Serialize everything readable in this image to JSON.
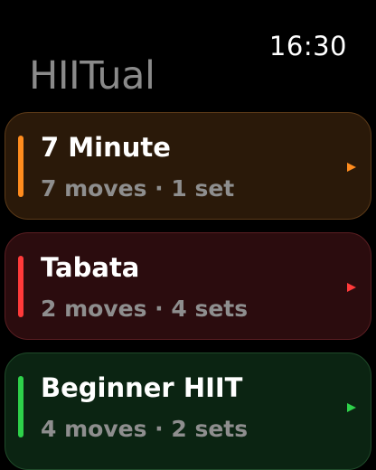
{
  "status_bar": {
    "time": "16:30"
  },
  "app": {
    "title": "HIITual"
  },
  "workouts": [
    {
      "name": "7 Minute",
      "meta": "7 moves · 1 set",
      "accent_color": "#ff8c1e",
      "bg_color": "#2a1909",
      "border_color": "#5c3a18"
    },
    {
      "name": "Tabata",
      "meta": "2 moves · 4 sets",
      "accent_color": "#ff3a3a",
      "bg_color": "#2b0c0e",
      "border_color": "#5a1e22"
    },
    {
      "name": "Beginner HIIT",
      "meta": "4 moves · 2 sets",
      "accent_color": "#2ed14a",
      "bg_color": "#0b2412",
      "border_color": "#1f4a29"
    }
  ],
  "icons": {
    "chevron": "chevron-right-icon"
  }
}
